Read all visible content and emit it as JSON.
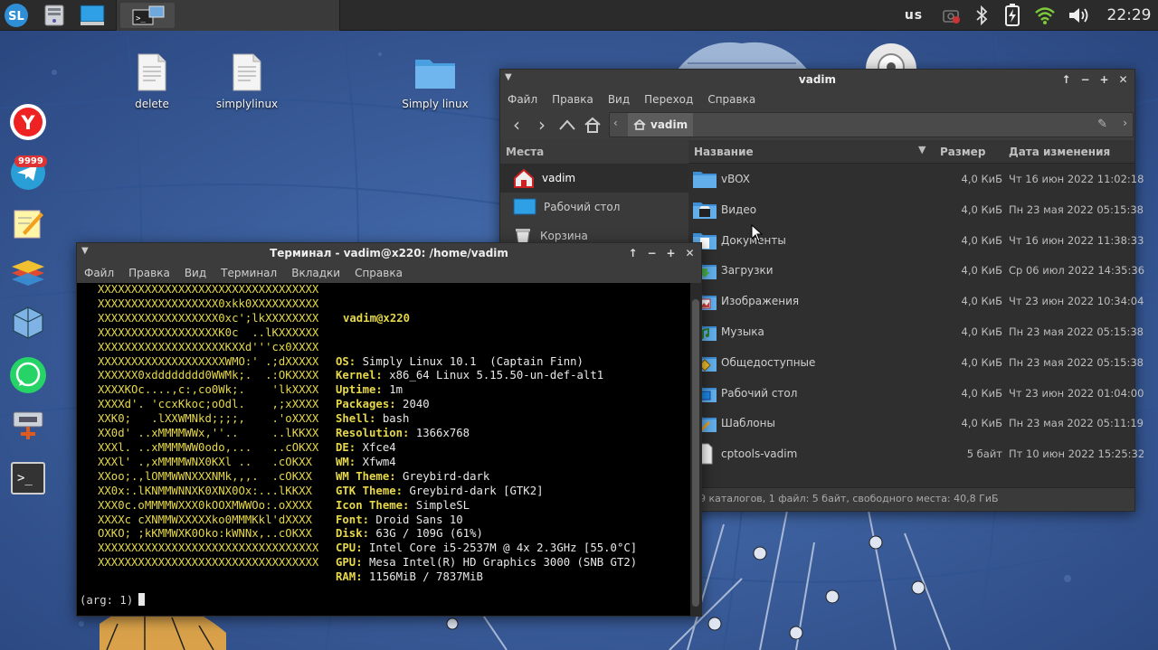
{
  "panel": {
    "keyboard_layout": "us",
    "clock": "22:29",
    "task_icons": [
      "terminal-icon",
      "file-manager-icon"
    ],
    "launchers": [
      "sl-menu-icon",
      "disk-icon",
      "desktop-icon"
    ]
  },
  "dock": {
    "telegram_badge": "9999",
    "items": [
      "yandex-browser",
      "telegram",
      "notes",
      "layers",
      "virtualbox",
      "whatsapp",
      "ethernet",
      "terminal"
    ]
  },
  "desktop": {
    "icons": [
      {
        "label": "delete"
      },
      {
        "label": "simplylinux"
      },
      {
        "label": "Simply linux"
      }
    ]
  },
  "file_manager": {
    "title": "vadim",
    "menu": [
      "Файл",
      "Правка",
      "Вид",
      "Переход",
      "Справка"
    ],
    "path_button": "vadim",
    "places_header": "Места",
    "places": [
      {
        "label": "vadim",
        "selected": true
      },
      {
        "label": "Рабочий стол",
        "selected": false
      },
      {
        "label": "Корзина",
        "selected": false
      }
    ],
    "columns": {
      "name": "Название",
      "size": "Размер",
      "modified": "Дата изменения"
    },
    "files": [
      {
        "name": "vBOX",
        "size": "4,0 КиБ",
        "modified": "Чт 16 июн 2022 11:02:18",
        "icon": "folder-icon"
      },
      {
        "name": "Видео",
        "size": "4,0 КиБ",
        "modified": "Пн 23 мая 2022 05:15:38",
        "icon": "video-folder-icon"
      },
      {
        "name": "Документы",
        "size": "4,0 КиБ",
        "modified": "Чт 16 июн 2022 11:38:33",
        "icon": "documents-folder-icon"
      },
      {
        "name": "Загрузки",
        "size": "4,0 КиБ",
        "modified": "Ср 06 июл 2022 14:35:36",
        "icon": "downloads-folder-icon"
      },
      {
        "name": "Изображения",
        "size": "4,0 КиБ",
        "modified": "Чт 23 июн 2022 10:34:04",
        "icon": "pictures-folder-icon"
      },
      {
        "name": "Музыка",
        "size": "4,0 КиБ",
        "modified": "Пн 23 мая 2022 05:15:38",
        "icon": "music-folder-icon"
      },
      {
        "name": "Общедоступные",
        "size": "4,0 КиБ",
        "modified": "Пн 23 мая 2022 05:15:38",
        "icon": "public-folder-icon"
      },
      {
        "name": "Рабочий стол",
        "size": "4,0 КиБ",
        "modified": "Чт 23 июн 2022 01:04:00",
        "icon": "desktop-folder-icon"
      },
      {
        "name": "Шаблоны",
        "size": "4,0 КиБ",
        "modified": "Пн 23 мая 2022 05:11:19",
        "icon": "templates-folder-icon"
      },
      {
        "name": "cptools-vadim",
        "size": "5 байт",
        "modified": "Пт 10 июн 2022 15:25:32",
        "icon": "file-icon"
      }
    ],
    "status": "9 каталогов, 1 файл: 5 байт, свободного места: 40,8 ГиБ"
  },
  "terminal": {
    "title": "Терминал - vadim@x220: /home/vadim",
    "menu": [
      "Файл",
      "Правка",
      "Вид",
      "Терминал",
      "Вкладки",
      "Справка"
    ],
    "logo_lines": [
      "XXXXXXXXXXXXXXXXXXXXXXXXXXXXXXXXX",
      "XXXXXXXXXXXXXXXXXX0xkk0XXXXXXXXXX",
      "XXXXXXXXXXXXXXXXXX0xc';lkXXXXXXXX",
      "XXXXXXXXXXXXXXXXXXK0c  ..lKXXXXXX",
      "XXXXXXXXXXXXXXXXXXXKXXd'''cx0XXXX",
      "XXXXXXXXXXXXXXXXXXXWMO:' .;dXXXXX",
      "XXXXXX0xdddddddd0WWMk;.  .:OKXXXX",
      "XXXXKOc....,c:,co0Wk;.    'lkXXXX",
      "XXXXd'. 'ccxKkoc;oOdl.    ,;xXXXX",
      "XXK0;   .lXXWMNkd;;;;,    .'oXXXX",
      "XX0d' ..xMMMMWWx,''..     ..lKKXX",
      "XXXl. ..xMMMMWW0odo,...   ..cOKXX",
      "XXXl' .,xMMMMWNX0KXl ..   .cOKXX",
      "XXoo;.,lOMMWWNXXXNMk,,,.  .cOKXX",
      "XX0x:.lKNMMWNNXK0XNX0Ox:...lKKXX",
      "XXX0c.oMMMMWXXX0kOOXMWWOo:.oXXXX",
      "XXXXc cXNMMWXXXXXko0MMMKkl'dXXXX",
      "OXKO; ;kKMMWXK0Oko:kWNNx,..cOKXX",
      "XXXXXXXXXXXXXXXXXXXXXXXXXXXXXXXXX",
      "XXXXXXXXXXXXXXXXXXXXXXXXXXXXXXXXX"
    ],
    "userhost": "vadim@x220",
    "info": [
      {
        "key": "OS:",
        "value": "Simply Linux 10.1  (Captain Finn)"
      },
      {
        "key": "Kernel:",
        "value": "x86_64 Linux 5.15.50-un-def-alt1"
      },
      {
        "key": "Uptime:",
        "value": "1m"
      },
      {
        "key": "Packages:",
        "value": "2040"
      },
      {
        "key": "Shell:",
        "value": "bash"
      },
      {
        "key": "Resolution:",
        "value": "1366x768"
      },
      {
        "key": "DE:",
        "value": "Xfce4"
      },
      {
        "key": "WM:",
        "value": "Xfwm4"
      },
      {
        "key": "WM Theme:",
        "value": "Greybird-dark"
      },
      {
        "key": "GTK Theme:",
        "value": "Greybird-dark [GTK2]"
      },
      {
        "key": "Icon Theme:",
        "value": "SimpleSL"
      },
      {
        "key": "Font:",
        "value": "Droid Sans 10"
      },
      {
        "key": "Disk:",
        "value": "63G / 109G (61%)"
      },
      {
        "key": "CPU:",
        "value": "Intel Core i5-2537M @ 4x 2.3GHz [55.0°C]"
      },
      {
        "key": "GPU:",
        "value": "Mesa Intel(R) HD Graphics 3000 (SNB GT2)"
      },
      {
        "key": "RAM:",
        "value": "1156MiB / 7837MiB"
      }
    ],
    "prompt": "(arg: 1)"
  }
}
